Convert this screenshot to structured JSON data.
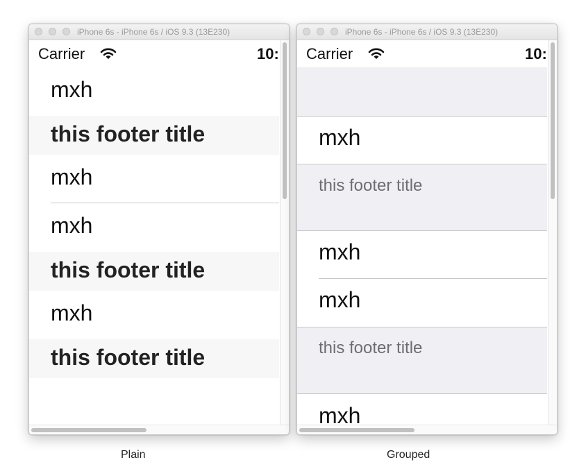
{
  "plain_window": {
    "title": "iPhone 6s - iPhone 6s / iOS 9.3 (13E230)",
    "status": {
      "carrier": "Carrier",
      "time": "10:"
    },
    "rows": [
      {
        "kind": "cell",
        "text": "mxh"
      },
      {
        "kind": "footer",
        "text": "this footer title"
      },
      {
        "kind": "cell",
        "text": "mxh"
      },
      {
        "kind": "cell",
        "text": "mxh"
      },
      {
        "kind": "footer",
        "text": "this footer title"
      },
      {
        "kind": "cell",
        "text": "mxh"
      },
      {
        "kind": "footer",
        "text": "this footer title"
      }
    ],
    "caption": "Plain"
  },
  "grouped_window": {
    "title": "iPhone 6s - iPhone 6s / iOS 9.3 (13E230)",
    "status": {
      "carrier": "Carrier",
      "time": "10:"
    },
    "rows": [
      {
        "kind": "cell",
        "text": "mxh"
      },
      {
        "kind": "footer",
        "text": "this footer title"
      },
      {
        "kind": "cell",
        "text": "mxh"
      },
      {
        "kind": "cell",
        "text": "mxh"
      },
      {
        "kind": "footer",
        "text": "this footer title"
      },
      {
        "kind": "cell",
        "text": "mxh"
      }
    ],
    "caption": "Grouped"
  },
  "colors": {
    "grouped_background": "#efeff4",
    "plain_footer_background": "#f7f7f7",
    "separator": "#c8c7cc",
    "grouped_footer_text": "#6d6d72"
  },
  "icons": [
    "wifi-icon"
  ]
}
